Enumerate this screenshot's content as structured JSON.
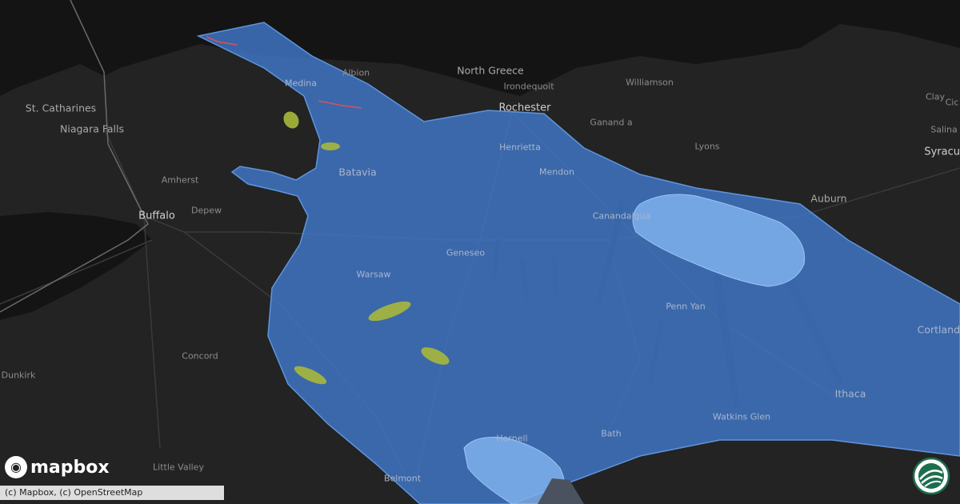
{
  "map": {
    "places": [
      {
        "name": "St. Catharines",
        "class": "city"
      },
      {
        "name": "Niagara Falls",
        "class": "city"
      },
      {
        "name": "Amherst",
        "class": ""
      },
      {
        "name": "Buffalo",
        "class": "major"
      },
      {
        "name": "Depew",
        "class": ""
      },
      {
        "name": "Dunkirk",
        "class": ""
      },
      {
        "name": "Concord",
        "class": ""
      },
      {
        "name": "Little Valley",
        "class": ""
      },
      {
        "name": "Medina",
        "class": "onblue"
      },
      {
        "name": "Albion",
        "class": ""
      },
      {
        "name": "Batavia",
        "class": "city onblue"
      },
      {
        "name": "Warsaw",
        "class": "onblue"
      },
      {
        "name": "Geneseo",
        "class": "onblue"
      },
      {
        "name": "Belmont",
        "class": "onblue"
      },
      {
        "name": "Hornell",
        "class": "onblue"
      },
      {
        "name": "North Greece",
        "class": "city"
      },
      {
        "name": "Irondequoit",
        "class": ""
      },
      {
        "name": "Rochester",
        "class": "major"
      },
      {
        "name": "Henrietta",
        "class": "onblue"
      },
      {
        "name": "Mendon",
        "class": "onblue"
      },
      {
        "name": "Williamson",
        "class": ""
      },
      {
        "name": "Ganand a",
        "class": ""
      },
      {
        "name": "Lyons",
        "class": ""
      },
      {
        "name": "Canandaigua",
        "class": "onblue"
      },
      {
        "name": "Penn Yan",
        "class": "onblue"
      },
      {
        "name": "Bath",
        "class": "onblue"
      },
      {
        "name": "Watkins Glen",
        "class": "onblue"
      },
      {
        "name": "Auburn",
        "class": "city"
      },
      {
        "name": "Ithaca",
        "class": "city onblue"
      },
      {
        "name": "Clay",
        "class": ""
      },
      {
        "name": "Cic",
        "class": ""
      },
      {
        "name": "Salina",
        "class": ""
      },
      {
        "name": "Syracu",
        "class": "major"
      },
      {
        "name": "Cortland",
        "class": "city onblue"
      }
    ],
    "colors": {
      "land": "#232323",
      "water": "#141414",
      "outlook_fill": "#3f78c8",
      "outlook_light": "#7fb1ee",
      "hail": "#a8b83a",
      "wind": "#c8526a"
    }
  },
  "branding": {
    "logo_text": "mapbox",
    "logo_icon": "mapbox-pin-icon",
    "attribution": "(c) Mapbox, (c) OpenStreetMap",
    "badge_icon": "globe-swirl-icon"
  }
}
